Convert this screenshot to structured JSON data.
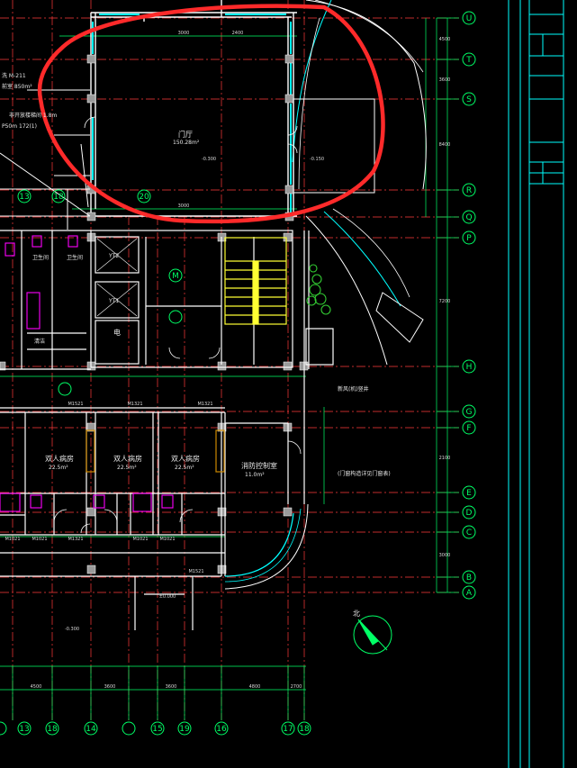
{
  "colors": {
    "background": "#000000",
    "wall": "#ffffff",
    "axis": "#ff3a3a",
    "dimension": "#00ff66",
    "window": "#00ffff",
    "stair": "#ffff33",
    "door": "#ff00ff",
    "highlight": "#ff2a2a",
    "plant": "#33cc33",
    "furniture": "#cc8800"
  },
  "right_axes": [
    "U",
    "T",
    "S",
    "R",
    "Q",
    "P",
    "H",
    "G",
    "F",
    "E",
    "D",
    "C",
    "B",
    "A"
  ],
  "bottom_axes": [
    "13",
    "18",
    "14",
    "15",
    "19",
    "16",
    "17",
    "18"
  ],
  "top_left_axes": [
    "13",
    "18",
    "20"
  ],
  "rooms": {
    "lobby": "门厅",
    "lobby_area": "150.28m²",
    "ward_1": "双人病房",
    "ward_2": "双人病房",
    "ward_3": "双人病房",
    "ward_area": "22.5m²",
    "fire_control": "消防控制室",
    "fire_area": "11.0m²",
    "bath_1": "卫生间",
    "bath_2": "卫生间",
    "elev_equipment": "电",
    "shaft": "YT2",
    "elev_1": "YT1",
    "clean": "清洁",
    "m_label": "M"
  },
  "left_notes": {
    "n1": "洗 M-211",
    "n2": "前室 850m²",
    "n3": "非开放楼梯间 1.8m",
    "n4": "P50m 172(1)"
  },
  "right_notes": {
    "n1": "新风(机)竖井",
    "n2": "(门窗构造详见门窗表)"
  },
  "doors": [
    "M1521",
    "M1321",
    "M1321",
    "M1321",
    "M1021",
    "M1021",
    "M1021",
    "M1021",
    "M1521"
  ],
  "compass_label": "北",
  "dims_bottom": [
    "4500",
    "3600",
    "3600",
    "4800",
    "2700"
  ],
  "dims_top": [
    "3000",
    "2400",
    "3000"
  ],
  "dims_right": [
    "4500",
    "3600",
    "8400",
    "7200",
    "2100",
    "3000"
  ],
  "elev_marks": [
    "-0.300",
    "-0.150",
    "±0.000",
    "-0.300"
  ]
}
